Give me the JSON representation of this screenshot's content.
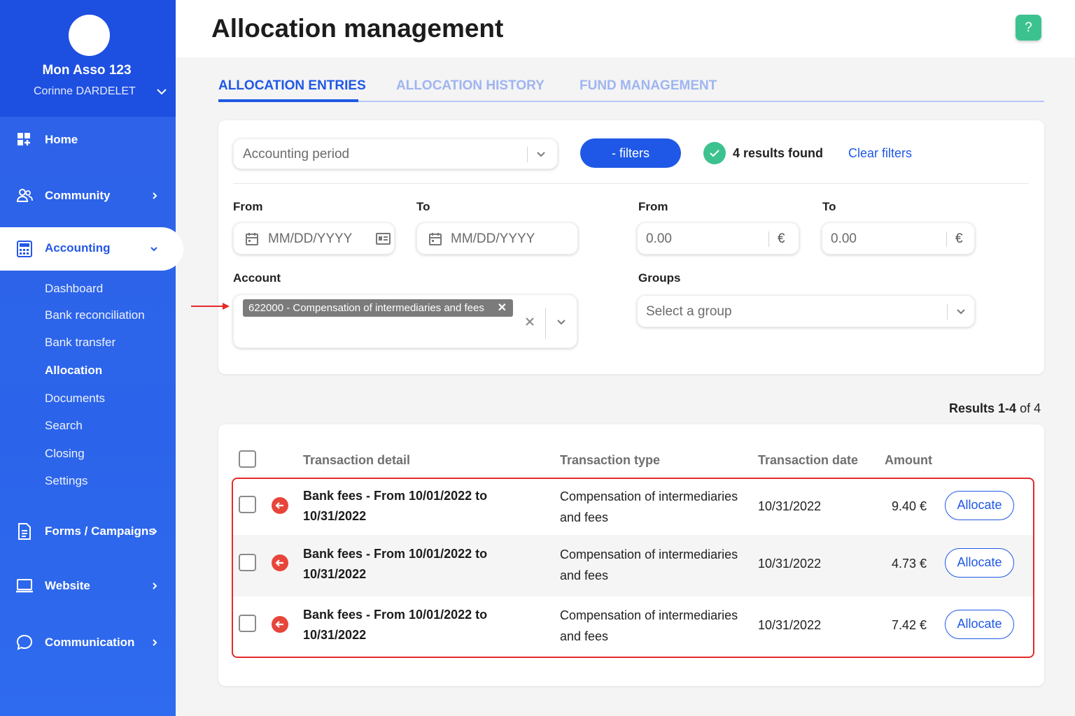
{
  "sidebar": {
    "org_name": "Mon Asso 123",
    "user_name": "Corinne DARDELET",
    "nav": {
      "home": "Home",
      "community": "Community",
      "accounting": "Accounting",
      "forms": "Forms / Campaigns",
      "website": "Website",
      "communication": "Communication"
    },
    "sub_items": [
      "Dashboard",
      "Bank reconciliation",
      "Bank transfer",
      "Allocation",
      "Documents",
      "Search",
      "Closing",
      "Settings"
    ],
    "active_sub_item": "Allocation"
  },
  "header": {
    "title": "Allocation management",
    "help": "?"
  },
  "tabs": [
    {
      "label": "ALLOCATION ENTRIES",
      "active": true
    },
    {
      "label": "ALLOCATION HISTORY",
      "active": false
    },
    {
      "label": "FUND MANAGEMENT",
      "active": false
    }
  ],
  "filters": {
    "accounting_period_placeholder": "Accounting period",
    "filters_button": "- filters",
    "results_found": "4 results found",
    "clear_filters": "Clear filters",
    "date_from_label": "From",
    "date_to_label": "To",
    "date_placeholder": "MM/DD/YYYY",
    "amount_from_label": "From",
    "amount_to_label": "To",
    "amount_placeholder": "0.00",
    "currency": "€",
    "account_label": "Account",
    "account_chip": "622000 - Compensation of intermediaries and fees",
    "groups_label": "Groups",
    "groups_placeholder": "Select a group"
  },
  "results": {
    "range": "Results 1-4",
    "of": "of 4"
  },
  "table": {
    "headers": [
      "Transaction detail",
      "Transaction type",
      "Transaction date",
      "Amount"
    ],
    "rows": [
      {
        "detail_line1": "Bank fees - From 10/01/2022 to",
        "detail_line2": "10/31/2022",
        "type_line1": "Compensation of intermediaries",
        "type_line2": "and fees",
        "date": "10/31/2022",
        "amount": "9.40 €",
        "action": "Allocate"
      },
      {
        "detail_line1": "Bank fees - From 10/01/2022 to",
        "detail_line2": "10/31/2022",
        "type_line1": "Compensation of intermediaries",
        "type_line2": "and fees",
        "date": "10/31/2022",
        "amount": "4.73 €",
        "action": "Allocate"
      },
      {
        "detail_line1": "Bank fees - From 10/01/2022 to",
        "detail_line2": "10/31/2022",
        "type_line1": "Compensation of intermediaries",
        "type_line2": "and fees",
        "date": "10/31/2022",
        "amount": "7.42 €",
        "action": "Allocate"
      }
    ]
  },
  "colors": {
    "primary": "#1f58e6",
    "sidebar": "#2b64ea",
    "success": "#3cc28f",
    "debit_icon": "#e8453a",
    "highlight": "#e52a2a"
  },
  "icons": [
    "user-chevron-icon",
    "home-icon",
    "community-icon",
    "accounting-icon",
    "forms-icon",
    "website-icon",
    "communication-icon",
    "calendar-icon",
    "id-card-icon",
    "check-icon",
    "close-icon",
    "chevron-down-icon",
    "debit-arrow-icon",
    "help-icon"
  ]
}
